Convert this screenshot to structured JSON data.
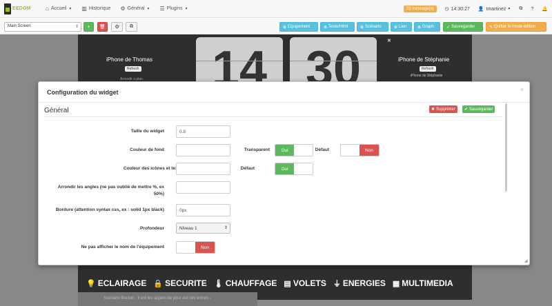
{
  "navbar": {
    "logo_text": "EEDOM",
    "menu": [
      {
        "label": "Accueil",
        "icon": "home-icon"
      },
      {
        "label": "Historique",
        "icon": "chart-icon"
      },
      {
        "label": "Général",
        "icon": "cogs-icon"
      },
      {
        "label": "Plugins",
        "icon": "tasks-icon"
      }
    ],
    "messages_badge": "23 message(s)",
    "time": "14:30:27",
    "user": "tmartinez"
  },
  "toolbar": {
    "screen_select": "Main Screen",
    "actions": [
      {
        "label": "Equipement",
        "color": "#5bc0de"
      },
      {
        "label": "Texte/Html",
        "color": "#5bc0de"
      },
      {
        "label": "Scénario",
        "color": "#5bc0de"
      },
      {
        "label": "Lien",
        "color": "#5bc0de"
      },
      {
        "label": "Graph",
        "color": "#5bc0de"
      },
      {
        "label": "Sauvegarder",
        "color": "#5cb85c"
      },
      {
        "label": "Quitter le mode édition",
        "color": "#f0ad4e"
      }
    ]
  },
  "dashboard": {
    "clock_hours": "14",
    "clock_minutes": "30",
    "iphone_left": "iPhone de Thomas",
    "iphone_right": "iPhone de Stéphanie",
    "refresh_label": "Refresh",
    "sub_right": "iPhone de Stéphanie",
    "sub_left": "Arrondir a plan",
    "categories": [
      {
        "label": "ECLAIRAGE",
        "icon": "lightbulb-icon"
      },
      {
        "label": "SECURITE",
        "icon": "lock-icon"
      },
      {
        "label": "CHAUFFAGE",
        "icon": "thermometer-icon"
      },
      {
        "label": "VOLETS",
        "icon": "shutter-icon"
      },
      {
        "label": "ENERGIES",
        "icon": "plug-icon"
      },
      {
        "label": "MULTIMEDIA",
        "icon": "film-icon"
      }
    ],
    "footer_text": "Scenario Bouton : Il est les appels de pour est ces entres -"
  },
  "modal": {
    "title": "Configuration du widget",
    "section": "Général",
    "delete_label": "Supprimer",
    "save_label": "Sauvegarder",
    "fields": {
      "size_label": "Taille du widget",
      "size_value": "0.8",
      "bg_label": "Couleur de fond",
      "transparent_label": "Transparent",
      "default_label": "Défaut",
      "icons_label": "Couleur des icônes et textes",
      "default2_label": "Défaut",
      "radius_label_1": "Arrondir les angles (ne pas oublié de mettre %, ex",
      "radius_label_2": "50%)",
      "border_label": "Bordure (attention syntax css, ex : solid 1px black)",
      "border_value": "0px",
      "depth_label": "Profondeur",
      "depth_value": "Niveau 1",
      "hide_name_label": "Ne pas afficher le nom de l'équipement"
    },
    "toggle_on": "Oui",
    "toggle_off": "Non"
  }
}
